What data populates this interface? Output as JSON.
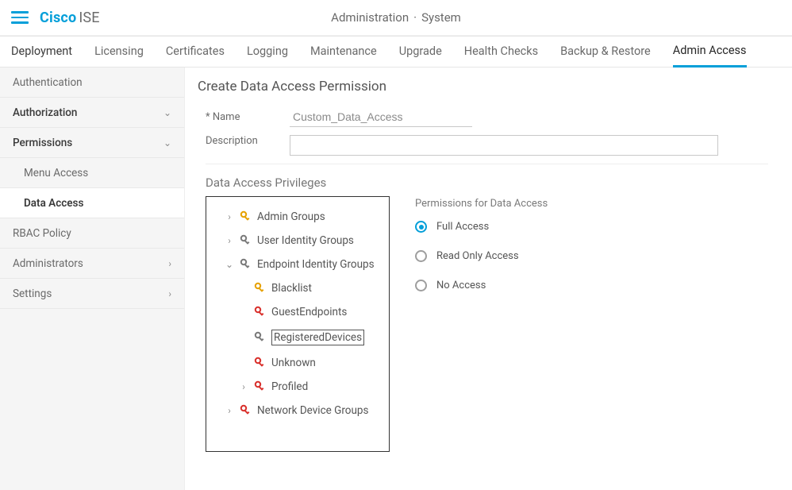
{
  "brand": {
    "cisco": "Cisco",
    "ise": "ISE"
  },
  "breadcrumb": {
    "section": "Administration",
    "page": "System"
  },
  "tabs": [
    "Deployment",
    "Licensing",
    "Certificates",
    "Logging",
    "Maintenance",
    "Upgrade",
    "Health Checks",
    "Backup & Restore",
    "Admin Access"
  ],
  "active_tab": 8,
  "sidebar": {
    "authentication": "Authentication",
    "authorization": "Authorization",
    "permissions": "Permissions",
    "menu_access": "Menu Access",
    "data_access": "Data Access",
    "rbac_policy": "RBAC Policy",
    "administrators": "Administrators",
    "settings": "Settings"
  },
  "page": {
    "title": "Create Data Access Permission",
    "name_label": "Name",
    "name_value": "Custom_Data_Access",
    "desc_label": "Description",
    "desc_value": "",
    "section": "Data Access Privileges",
    "perm_title": "Permissions for Data Access",
    "radios": {
      "full": "Full Access",
      "readonly": "Read Only Access",
      "none": "No Access"
    },
    "selected_radio": "full"
  },
  "tree": {
    "admin_groups": "Admin Groups",
    "user_identity_groups": "User Identity Groups",
    "endpoint_identity_groups": "Endpoint Identity Groups",
    "blacklist": "Blacklist",
    "guest_endpoints": "GuestEndpoints",
    "registered_devices": "RegisteredDevices",
    "unknown": "Unknown",
    "profiled": "Profiled",
    "network_device_groups": "Network Device Groups"
  }
}
